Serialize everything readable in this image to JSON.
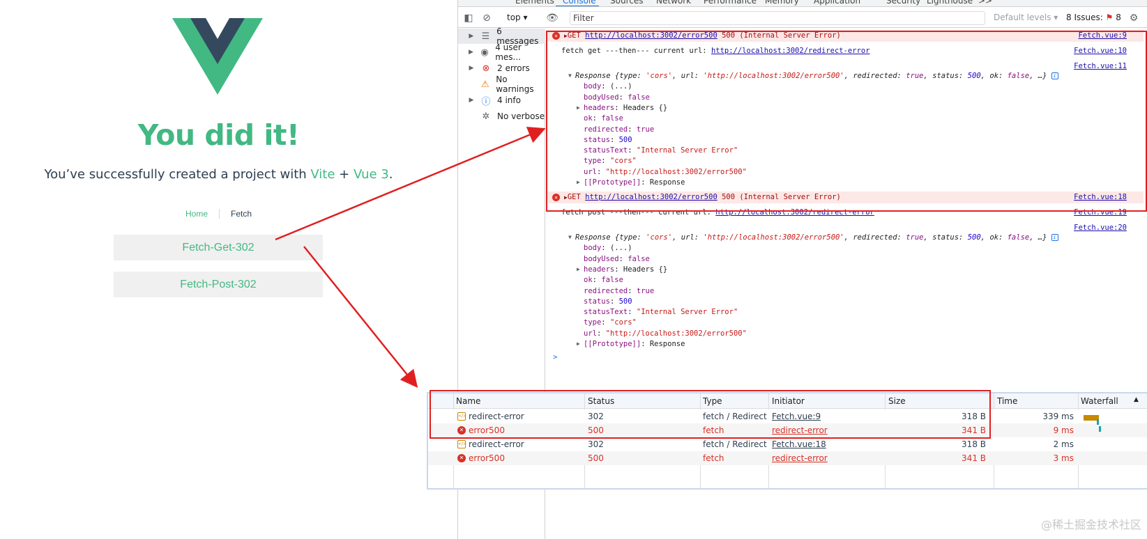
{
  "app": {
    "title": "You did it!",
    "subtitle_prefix": "You’ve successfully created a project with ",
    "subtitle_vite": "Vite",
    "subtitle_plus": " + ",
    "subtitle_vue": "Vue 3",
    "subtitle_suffix": ".",
    "nav": {
      "home": "Home",
      "fetch": "Fetch"
    },
    "buttons": {
      "get": "Fetch-Get-302",
      "post": "Fetch-Post-302"
    },
    "logo_colors": {
      "outer": "#42b883",
      "inner": "#35495e"
    }
  },
  "devtools": {
    "tabs": [
      "Elements",
      "Console",
      "Sources",
      "Network",
      "Performance",
      "Memory",
      "Application",
      "Security",
      "Lighthouse",
      ">>"
    ],
    "toolbar": {
      "context": "top",
      "filter_placeholder": "Filter",
      "levels": "Default levels",
      "issues_label": "8 Issues:",
      "issues_count": "8",
      "error_count": "2",
      "warn_count": "8"
    },
    "sidebar": [
      {
        "label": "6 messages",
        "icon": "list-icon"
      },
      {
        "label": "4 user mes...",
        "icon": "user-icon"
      },
      {
        "label": "2 errors",
        "icon": "error-icon"
      },
      {
        "label": "No warnings",
        "icon": "warning-icon"
      },
      {
        "label": "4 info",
        "icon": "info-icon"
      },
      {
        "label": "No verbose",
        "icon": "bug-icon"
      }
    ],
    "console": {
      "get_error": {
        "method": "GET",
        "url": "http://localhost:3002/error500",
        "status": "500 (Internal Server Error)",
        "src": "Fetch.vue:9"
      },
      "get_then": {
        "text": "fetch get ---then--- current url:",
        "url": "http://localhost:3002/redirect-error",
        "src": "Fetch.vue:10"
      },
      "get_src2": "Fetch.vue:11",
      "post_error": {
        "method": "GET",
        "url": "http://localhost:3002/error500",
        "status": "500 (Internal Server Error)",
        "src": "Fetch.vue:18"
      },
      "post_then": {
        "text": "fetch post ---then--- current url:",
        "url": "http://localhost:3002/redirect-error",
        "src": "Fetch.vue:19"
      },
      "post_src2": "Fetch.vue:20",
      "response": {
        "summary_label": "Response",
        "summary_open": "{",
        "type_key": "type: ",
        "type_val": "'cors'",
        "url_key": ", url: ",
        "url_val": "'http://localhost:3002/error500'",
        "redirected_key": ", redirected: ",
        "redirected_val": "true",
        "status_key": ", status: ",
        "status_val": "500",
        "ok_key": ", ok: ",
        "ok_val": "false",
        "summary_close": ", …}",
        "props": [
          {
            "key": "body",
            "value": "(...)",
            "kind": "plain",
            "expandable": false
          },
          {
            "key": "bodyUsed",
            "value": "false",
            "kind": "kw",
            "expandable": false
          },
          {
            "key": "headers",
            "value": "Headers {}",
            "kind": "plain",
            "expandable": true
          },
          {
            "key": "ok",
            "value": "false",
            "kind": "kw",
            "expandable": false
          },
          {
            "key": "redirected",
            "value": "true",
            "kind": "kw",
            "expandable": false
          },
          {
            "key": "status",
            "value": "500",
            "kind": "num",
            "expandable": false
          },
          {
            "key": "statusText",
            "value": "\"Internal Server Error\"",
            "kind": "str",
            "expandable": false
          },
          {
            "key": "type",
            "value": "\"cors\"",
            "kind": "str",
            "expandable": false
          },
          {
            "key": "url",
            "value": "\"http://localhost:3002/error500\"",
            "kind": "str",
            "expandable": false
          },
          {
            "key": "[[Prototype]]",
            "value": "Response",
            "kind": "plain",
            "expandable": true
          }
        ]
      },
      "prompt": ">"
    },
    "network": {
      "columns": [
        "Name",
        "Status",
        "Type",
        "Initiator",
        "Size",
        "Time",
        "Waterfall"
      ],
      "rows": [
        {
          "name": "redirect-error",
          "status": "302",
          "type": "fetch / Redirect",
          "initiator": "Fetch.vue:9",
          "size": "318 B",
          "time": "339 ms",
          "error": false
        },
        {
          "name": "error500",
          "status": "500",
          "type": "fetch",
          "initiator": "redirect-error",
          "size": "341 B",
          "time": "9 ms",
          "error": true
        },
        {
          "name": "redirect-error",
          "status": "302",
          "type": "fetch / Redirect",
          "initiator": "Fetch.vue:18",
          "size": "318 B",
          "time": "2 ms",
          "error": false
        },
        {
          "name": "error500",
          "status": "500",
          "type": "fetch",
          "initiator": "redirect-error",
          "size": "341 B",
          "time": "3 ms",
          "error": true
        }
      ]
    }
  },
  "watermark": "@稀土掘金技术社区",
  "colors": {
    "vue_green": "#42b883",
    "annotation_red": "#e02020",
    "link_blue": "#1a0dab",
    "error_red": "#d93025"
  }
}
